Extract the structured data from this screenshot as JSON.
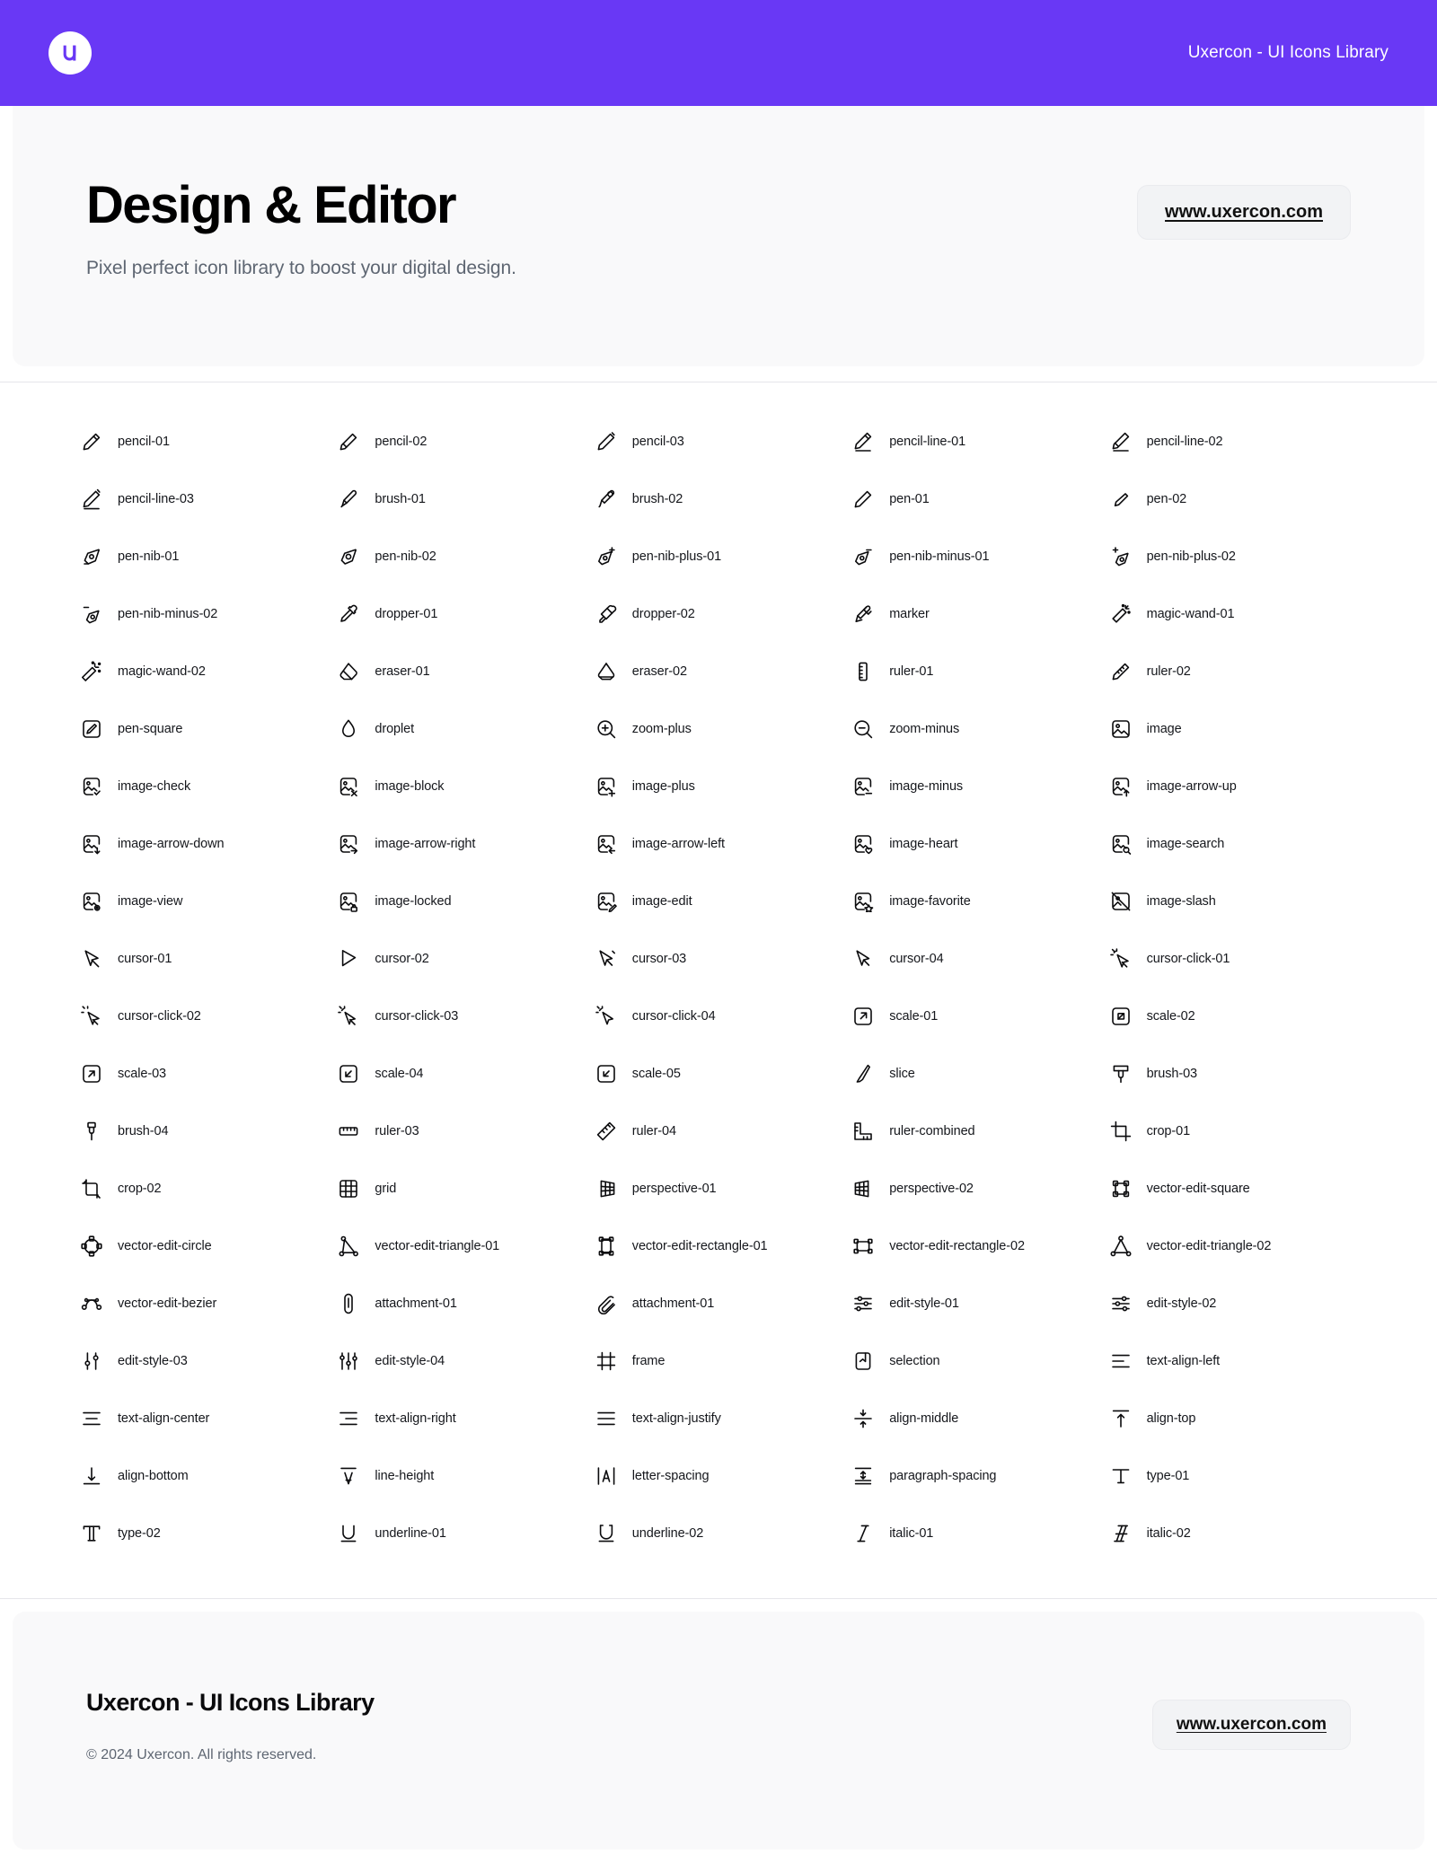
{
  "header": {
    "logo_icon": "uxercon-logo-icon",
    "logo_letter": "u",
    "title": "Uxercon - UI Icons Library",
    "background_color": "#6938F5"
  },
  "hero": {
    "title": "Design & Editor",
    "subtitle": "Pixel perfect icon library to boost your digital design.",
    "url_label": "www.uxercon.com",
    "background_color": "#F9F9FA"
  },
  "footer": {
    "title": "Uxercon - UI Icons Library",
    "copyright": "© 2024 Uxercon. All rights reserved.",
    "url_label": "www.uxercon.com",
    "background_color": "#F9F9FA"
  },
  "grid": {
    "columns": 5,
    "icon_color": "#0B0B0D",
    "items": [
      {
        "name": "pencil-01",
        "icon": "pencil-01-icon"
      },
      {
        "name": "pencil-02",
        "icon": "pencil-02-icon"
      },
      {
        "name": "pencil-03",
        "icon": "pencil-03-icon"
      },
      {
        "name": "pencil-line-01",
        "icon": "pencil-line-01-icon"
      },
      {
        "name": "pencil-line-02",
        "icon": "pencil-line-02-icon"
      },
      {
        "name": "pencil-line-03",
        "icon": "pencil-line-03-icon"
      },
      {
        "name": "brush-01",
        "icon": "brush-01-icon"
      },
      {
        "name": "brush-02",
        "icon": "brush-02-icon"
      },
      {
        "name": "pen-01",
        "icon": "pen-01-icon"
      },
      {
        "name": "pen-02",
        "icon": "pen-02-icon"
      },
      {
        "name": "pen-nib-01",
        "icon": "pen-nib-01-icon"
      },
      {
        "name": "pen-nib-02",
        "icon": "pen-nib-02-icon"
      },
      {
        "name": "pen-nib-plus-01",
        "icon": "pen-nib-plus-01-icon"
      },
      {
        "name": "pen-nib-minus-01",
        "icon": "pen-nib-minus-01-icon"
      },
      {
        "name": "pen-nib-plus-02",
        "icon": "pen-nib-plus-02-icon"
      },
      {
        "name": "pen-nib-minus-02",
        "icon": "pen-nib-minus-02-icon"
      },
      {
        "name": "dropper-01",
        "icon": "dropper-01-icon"
      },
      {
        "name": "dropper-02",
        "icon": "dropper-02-icon"
      },
      {
        "name": "marker",
        "icon": "marker-icon"
      },
      {
        "name": "magic-wand-01",
        "icon": "magic-wand-01-icon"
      },
      {
        "name": "magic-wand-02",
        "icon": "magic-wand-02-icon"
      },
      {
        "name": "eraser-01",
        "icon": "eraser-01-icon"
      },
      {
        "name": "eraser-02",
        "icon": "eraser-02-icon"
      },
      {
        "name": "ruler-01",
        "icon": "ruler-01-icon"
      },
      {
        "name": "ruler-02",
        "icon": "ruler-02-icon"
      },
      {
        "name": "pen-square",
        "icon": "pen-square-icon"
      },
      {
        "name": "droplet",
        "icon": "droplet-icon"
      },
      {
        "name": "zoom-plus",
        "icon": "zoom-plus-icon"
      },
      {
        "name": "zoom-minus",
        "icon": "zoom-minus-icon"
      },
      {
        "name": "image",
        "icon": "image-icon"
      },
      {
        "name": "image-check",
        "icon": "image-check-icon"
      },
      {
        "name": "image-block",
        "icon": "image-block-icon"
      },
      {
        "name": "image-plus",
        "icon": "image-plus-icon"
      },
      {
        "name": "image-minus",
        "icon": "image-minus-icon"
      },
      {
        "name": "image-arrow-up",
        "icon": "image-arrow-up-icon"
      },
      {
        "name": "image-arrow-down",
        "icon": "image-arrow-down-icon"
      },
      {
        "name": "image-arrow-right",
        "icon": "image-arrow-right-icon"
      },
      {
        "name": "image-arrow-left",
        "icon": "image-arrow-left-icon"
      },
      {
        "name": "image-heart",
        "icon": "image-heart-icon"
      },
      {
        "name": "image-search",
        "icon": "image-search-icon"
      },
      {
        "name": "image-view",
        "icon": "image-view-icon"
      },
      {
        "name": "image-locked",
        "icon": "image-locked-icon"
      },
      {
        "name": "image-edit",
        "icon": "image-edit-icon"
      },
      {
        "name": "image-favorite",
        "icon": "image-favorite-icon"
      },
      {
        "name": "image-slash",
        "icon": "image-slash-icon"
      },
      {
        "name": "cursor-01",
        "icon": "cursor-01-icon"
      },
      {
        "name": "cursor-02",
        "icon": "cursor-02-icon"
      },
      {
        "name": "cursor-03",
        "icon": "cursor-03-icon"
      },
      {
        "name": "cursor-04",
        "icon": "cursor-04-icon"
      },
      {
        "name": "cursor-click-01",
        "icon": "cursor-click-01-icon"
      },
      {
        "name": "cursor-click-02",
        "icon": "cursor-click-02-icon"
      },
      {
        "name": "cursor-click-03",
        "icon": "cursor-click-03-icon"
      },
      {
        "name": "cursor-click-04",
        "icon": "cursor-click-04-icon"
      },
      {
        "name": "scale-01",
        "icon": "scale-01-icon"
      },
      {
        "name": "scale-02",
        "icon": "scale-02-icon"
      },
      {
        "name": "scale-03",
        "icon": "scale-03-icon"
      },
      {
        "name": "scale-04",
        "icon": "scale-04-icon"
      },
      {
        "name": "scale-05",
        "icon": "scale-05-icon"
      },
      {
        "name": "slice",
        "icon": "slice-icon"
      },
      {
        "name": "brush-03",
        "icon": "brush-03-icon"
      },
      {
        "name": "brush-04",
        "icon": "brush-04-icon"
      },
      {
        "name": "ruler-03",
        "icon": "ruler-03-icon"
      },
      {
        "name": "ruler-04",
        "icon": "ruler-04-icon"
      },
      {
        "name": "ruler-combined",
        "icon": "ruler-combined-icon"
      },
      {
        "name": "crop-01",
        "icon": "crop-01-icon"
      },
      {
        "name": "crop-02",
        "icon": "crop-02-icon"
      },
      {
        "name": "grid",
        "icon": "grid-icon"
      },
      {
        "name": "perspective-01",
        "icon": "perspective-01-icon"
      },
      {
        "name": "perspective-02",
        "icon": "perspective-02-icon"
      },
      {
        "name": "vector-edit-square",
        "icon": "vector-edit-square-icon"
      },
      {
        "name": "vector-edit-circle",
        "icon": "vector-edit-circle-icon"
      },
      {
        "name": "vector-edit-triangle-01",
        "icon": "vector-edit-triangle-01-icon"
      },
      {
        "name": "vector-edit-rectangle-01",
        "icon": "vector-edit-rectangle-01-icon"
      },
      {
        "name": "vector-edit-rectangle-02",
        "icon": "vector-edit-rectangle-02-icon"
      },
      {
        "name": "vector-edit-triangle-02",
        "icon": "vector-edit-triangle-02-icon"
      },
      {
        "name": "vector-edit-bezier",
        "icon": "vector-edit-bezier-icon"
      },
      {
        "name": "attachment-01",
        "icon": "attachment-01-icon"
      },
      {
        "name": "attachment-01",
        "icon": "attachment-02-icon"
      },
      {
        "name": "edit-style-01",
        "icon": "edit-style-01-icon"
      },
      {
        "name": "edit-style-02",
        "icon": "edit-style-02-icon"
      },
      {
        "name": "edit-style-03",
        "icon": "edit-style-03-icon"
      },
      {
        "name": "edit-style-04",
        "icon": "edit-style-04-icon"
      },
      {
        "name": "frame",
        "icon": "frame-icon"
      },
      {
        "name": "selection",
        "icon": "selection-icon"
      },
      {
        "name": "text-align-left",
        "icon": "text-align-left-icon"
      },
      {
        "name": "text-align-center",
        "icon": "text-align-center-icon"
      },
      {
        "name": "text-align-right",
        "icon": "text-align-right-icon"
      },
      {
        "name": "text-align-justify",
        "icon": "text-align-justify-icon"
      },
      {
        "name": "align-middle",
        "icon": "align-middle-icon"
      },
      {
        "name": "align-top",
        "icon": "align-top-icon"
      },
      {
        "name": "align-bottom",
        "icon": "align-bottom-icon"
      },
      {
        "name": "line-height",
        "icon": "line-height-icon"
      },
      {
        "name": "letter-spacing",
        "icon": "letter-spacing-icon"
      },
      {
        "name": "paragraph-spacing",
        "icon": "paragraph-spacing-icon"
      },
      {
        "name": "type-01",
        "icon": "type-01-icon"
      },
      {
        "name": "type-02",
        "icon": "type-02-icon"
      },
      {
        "name": "underline-01",
        "icon": "underline-01-icon"
      },
      {
        "name": "underline-02",
        "icon": "underline-02-icon"
      },
      {
        "name": "italic-01",
        "icon": "italic-01-icon"
      },
      {
        "name": "italic-02",
        "icon": "italic-02-icon"
      }
    ]
  }
}
